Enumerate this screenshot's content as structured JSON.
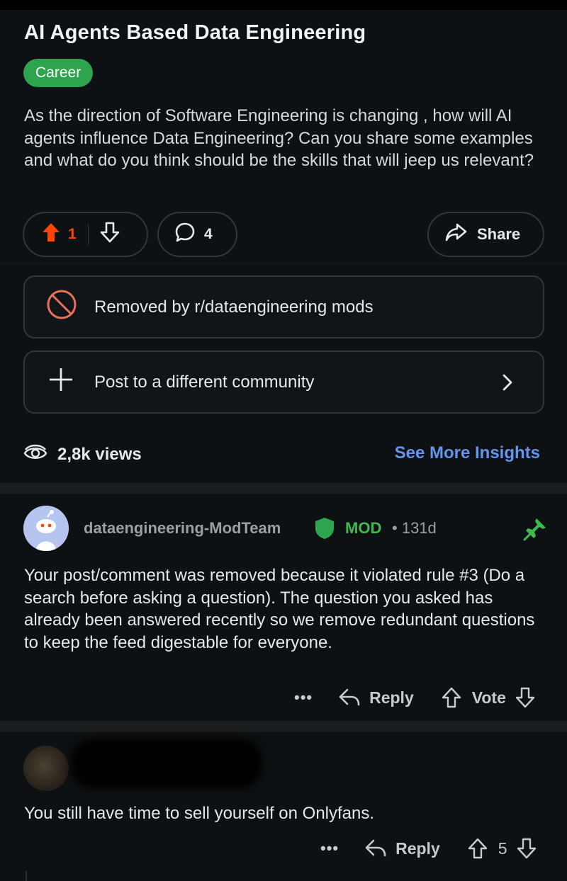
{
  "post": {
    "title": "AI Agents Based Data Engineering",
    "flair": "Career",
    "body": "As the direction of Software Engineering is changing , how will AI agents influence Data Engineering? Can you share some examples and what do you think should be the skills that will jeep us relevant?",
    "upvotes": "1",
    "comments": "4",
    "share_label": "Share"
  },
  "status": {
    "removed_text": "Removed by r/dataengineering mods",
    "repost_text": "Post to a different community"
  },
  "stats": {
    "views": "2,8k views",
    "insights_label": "See More Insights"
  },
  "comments": [
    {
      "author": "dataengineering-ModTeam",
      "badge": "MOD",
      "separator": "•",
      "time": "131d",
      "body": "Your post/comment was removed because it violated rule #3 (Do a search before asking a question). The question you asked has already been answered recently so we remove redundant questions to keep the feed digestable for everyone.",
      "more": "•••",
      "reply_label": "Reply",
      "vote_label": "Vote"
    },
    {
      "body": "You still have time to sell yourself on Onlyfans.",
      "more": "•••",
      "reply_label": "Reply",
      "score": "5"
    }
  ],
  "colors": {
    "background": "#0e1113",
    "flair": "#2ea44f",
    "upvote": "#ff4500",
    "removed": "#e8715a",
    "mod": "#3fb950",
    "link": "#6495ed"
  },
  "icons": [
    "upvote-icon",
    "downvote-icon",
    "comment-icon",
    "share-icon",
    "removed-icon",
    "plus-icon",
    "chevron-right-icon",
    "views-icon",
    "mod-shield-icon",
    "pin-icon",
    "reply-icon"
  ]
}
